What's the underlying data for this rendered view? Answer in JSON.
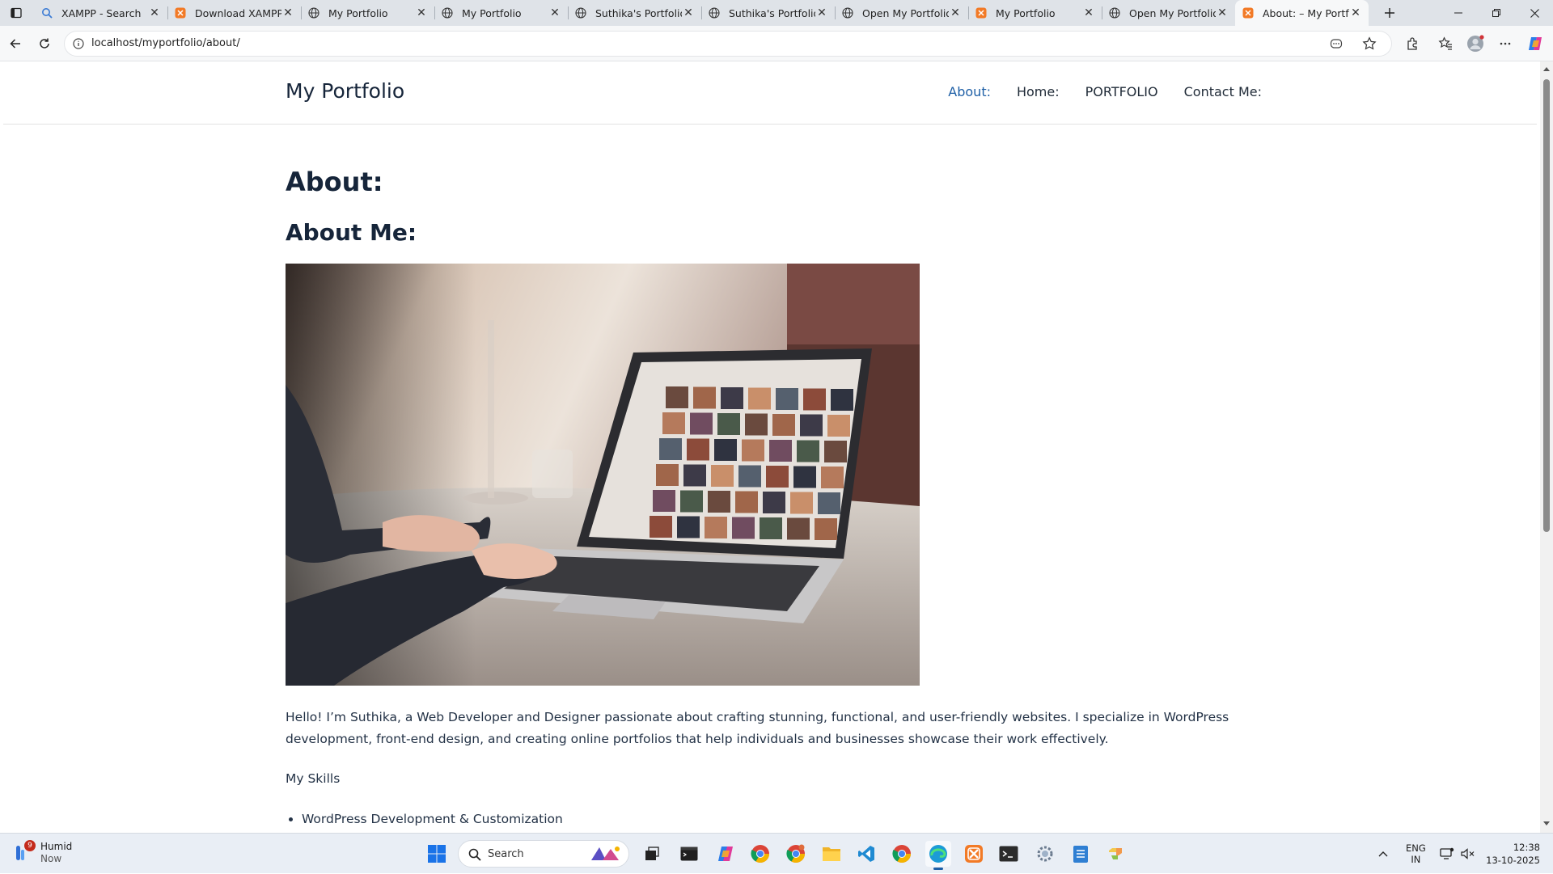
{
  "browser": {
    "tabs": [
      {
        "title": "XAMPP - Search",
        "icon": "search-favicon"
      },
      {
        "title": "Download XAMPP",
        "icon": "xampp-favicon"
      },
      {
        "title": "My Portfolio",
        "icon": "globe-favicon"
      },
      {
        "title": "My Portfolio",
        "icon": "globe-favicon"
      },
      {
        "title": "Suthika's Portfolio",
        "icon": "globe-favicon"
      },
      {
        "title": "Suthika's Portfolio",
        "icon": "globe-favicon"
      },
      {
        "title": "Open My Portfolio",
        "icon": "globe-favicon"
      },
      {
        "title": "My Portfolio",
        "icon": "xampp-favicon"
      },
      {
        "title": "Open My Portfolio",
        "icon": "globe-favicon"
      },
      {
        "title": "About: – My Portfolio",
        "icon": "xampp-favicon",
        "active": true
      }
    ],
    "url": "localhost/myportfolio/about/"
  },
  "site": {
    "title": "My Portfolio",
    "nav": [
      "About:",
      "Home:",
      "PORTFOLIO",
      "Contact Me:"
    ],
    "current_nav": "About:"
  },
  "page": {
    "heading": "About:",
    "subheading": "About Me:",
    "intro": "Hello! I’m Suthika, a Web Developer and Designer passionate about crafting stunning, functional, and user-friendly websites. I specialize in WordPress development, front-end design, and creating online portfolios that help individuals and businesses showcase their work effectively.",
    "skills_title": "My Skills",
    "skills": [
      "WordPress Development & Customization"
    ]
  },
  "taskbar": {
    "weather_badge": "9",
    "weather_label": "Humid",
    "weather_time": "Now",
    "search_placeholder": "Search",
    "lang_top": "ENG",
    "lang_bottom": "IN",
    "time": "12:38",
    "date": "13-10-2025"
  },
  "colors": {
    "accent": "#1e5fa6",
    "heading": "#16253a",
    "xampp": "#f27a26"
  }
}
